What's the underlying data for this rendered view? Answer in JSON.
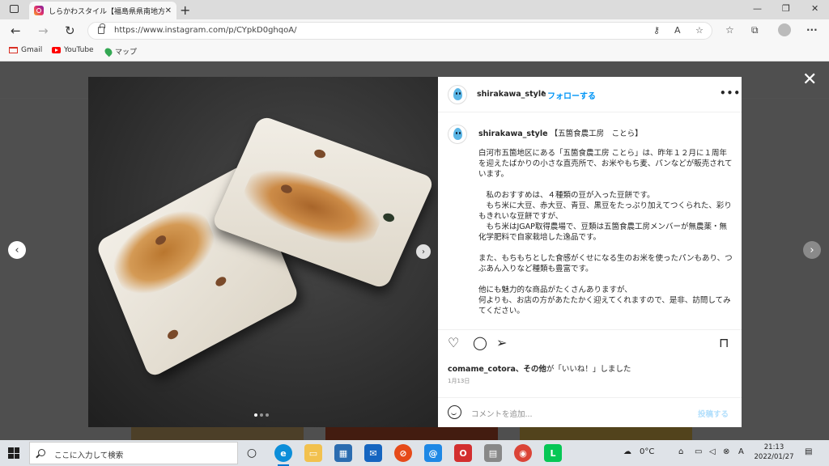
{
  "browser": {
    "tab_title": "しらかわスタイル【福島県県南地方振",
    "tab_close": "✕",
    "new_tab": "+",
    "url": "https://www.instagram.com/p/CYpkD0ghqoA/",
    "window_controls": {
      "minimize": "—",
      "restore": "❐",
      "close": "✕"
    },
    "bookmarks": [
      {
        "label": "Gmail",
        "icon": "gmail-icon"
      },
      {
        "label": "YouTube",
        "icon": "youtube-icon"
      },
      {
        "label": "マップ",
        "icon": "maps-icon"
      }
    ]
  },
  "post": {
    "username": "shirakawa_style",
    "separator": "•",
    "follow_label": "フォローする",
    "more_label": "•••",
    "caption_title": "【五箇食農工房　ことら】",
    "caption_body": "白河市五箇地区にある「五箇食農工房 ことら」は、昨年１２月に１周年を迎えたばかりの小さな直売所で、お米やもち麦、パンなどが販売されています。\n\n　私のおすすめは、４種類の豆が入った豆餅です。\n　もち米に大豆、赤大豆、青豆、黒豆をたっぷり加えてつくられた、彩りもきれいな豆餅ですが、\n　もち米はJGAP取得農場で、豆類は五箇食農工房メンバーが無農薬・無化学肥料で自家栽培した逸品です。\n\nまた、もちもちとした食感がくせになる生のお米を使ったパンもあり、つぶあん入りなど種類も豊富です。\n\n他にも魅力的な商品がたくさんありますが、\n何よりも、お店の方があたたかく迎えてくれますので、是非、訪問してみてください。",
    "liked_by_user": "comame_cotora",
    "liked_by_rest": "、その他",
    "liked_suffix": "が「いいね！」しました",
    "date": "1月13日",
    "comment_placeholder": "コメントを追加...",
    "post_button": "投稿する"
  },
  "taskbar": {
    "search_placeholder": "ここに入力して検索",
    "weather": "0°C",
    "time": "21:13",
    "date": "2022/01/27"
  }
}
